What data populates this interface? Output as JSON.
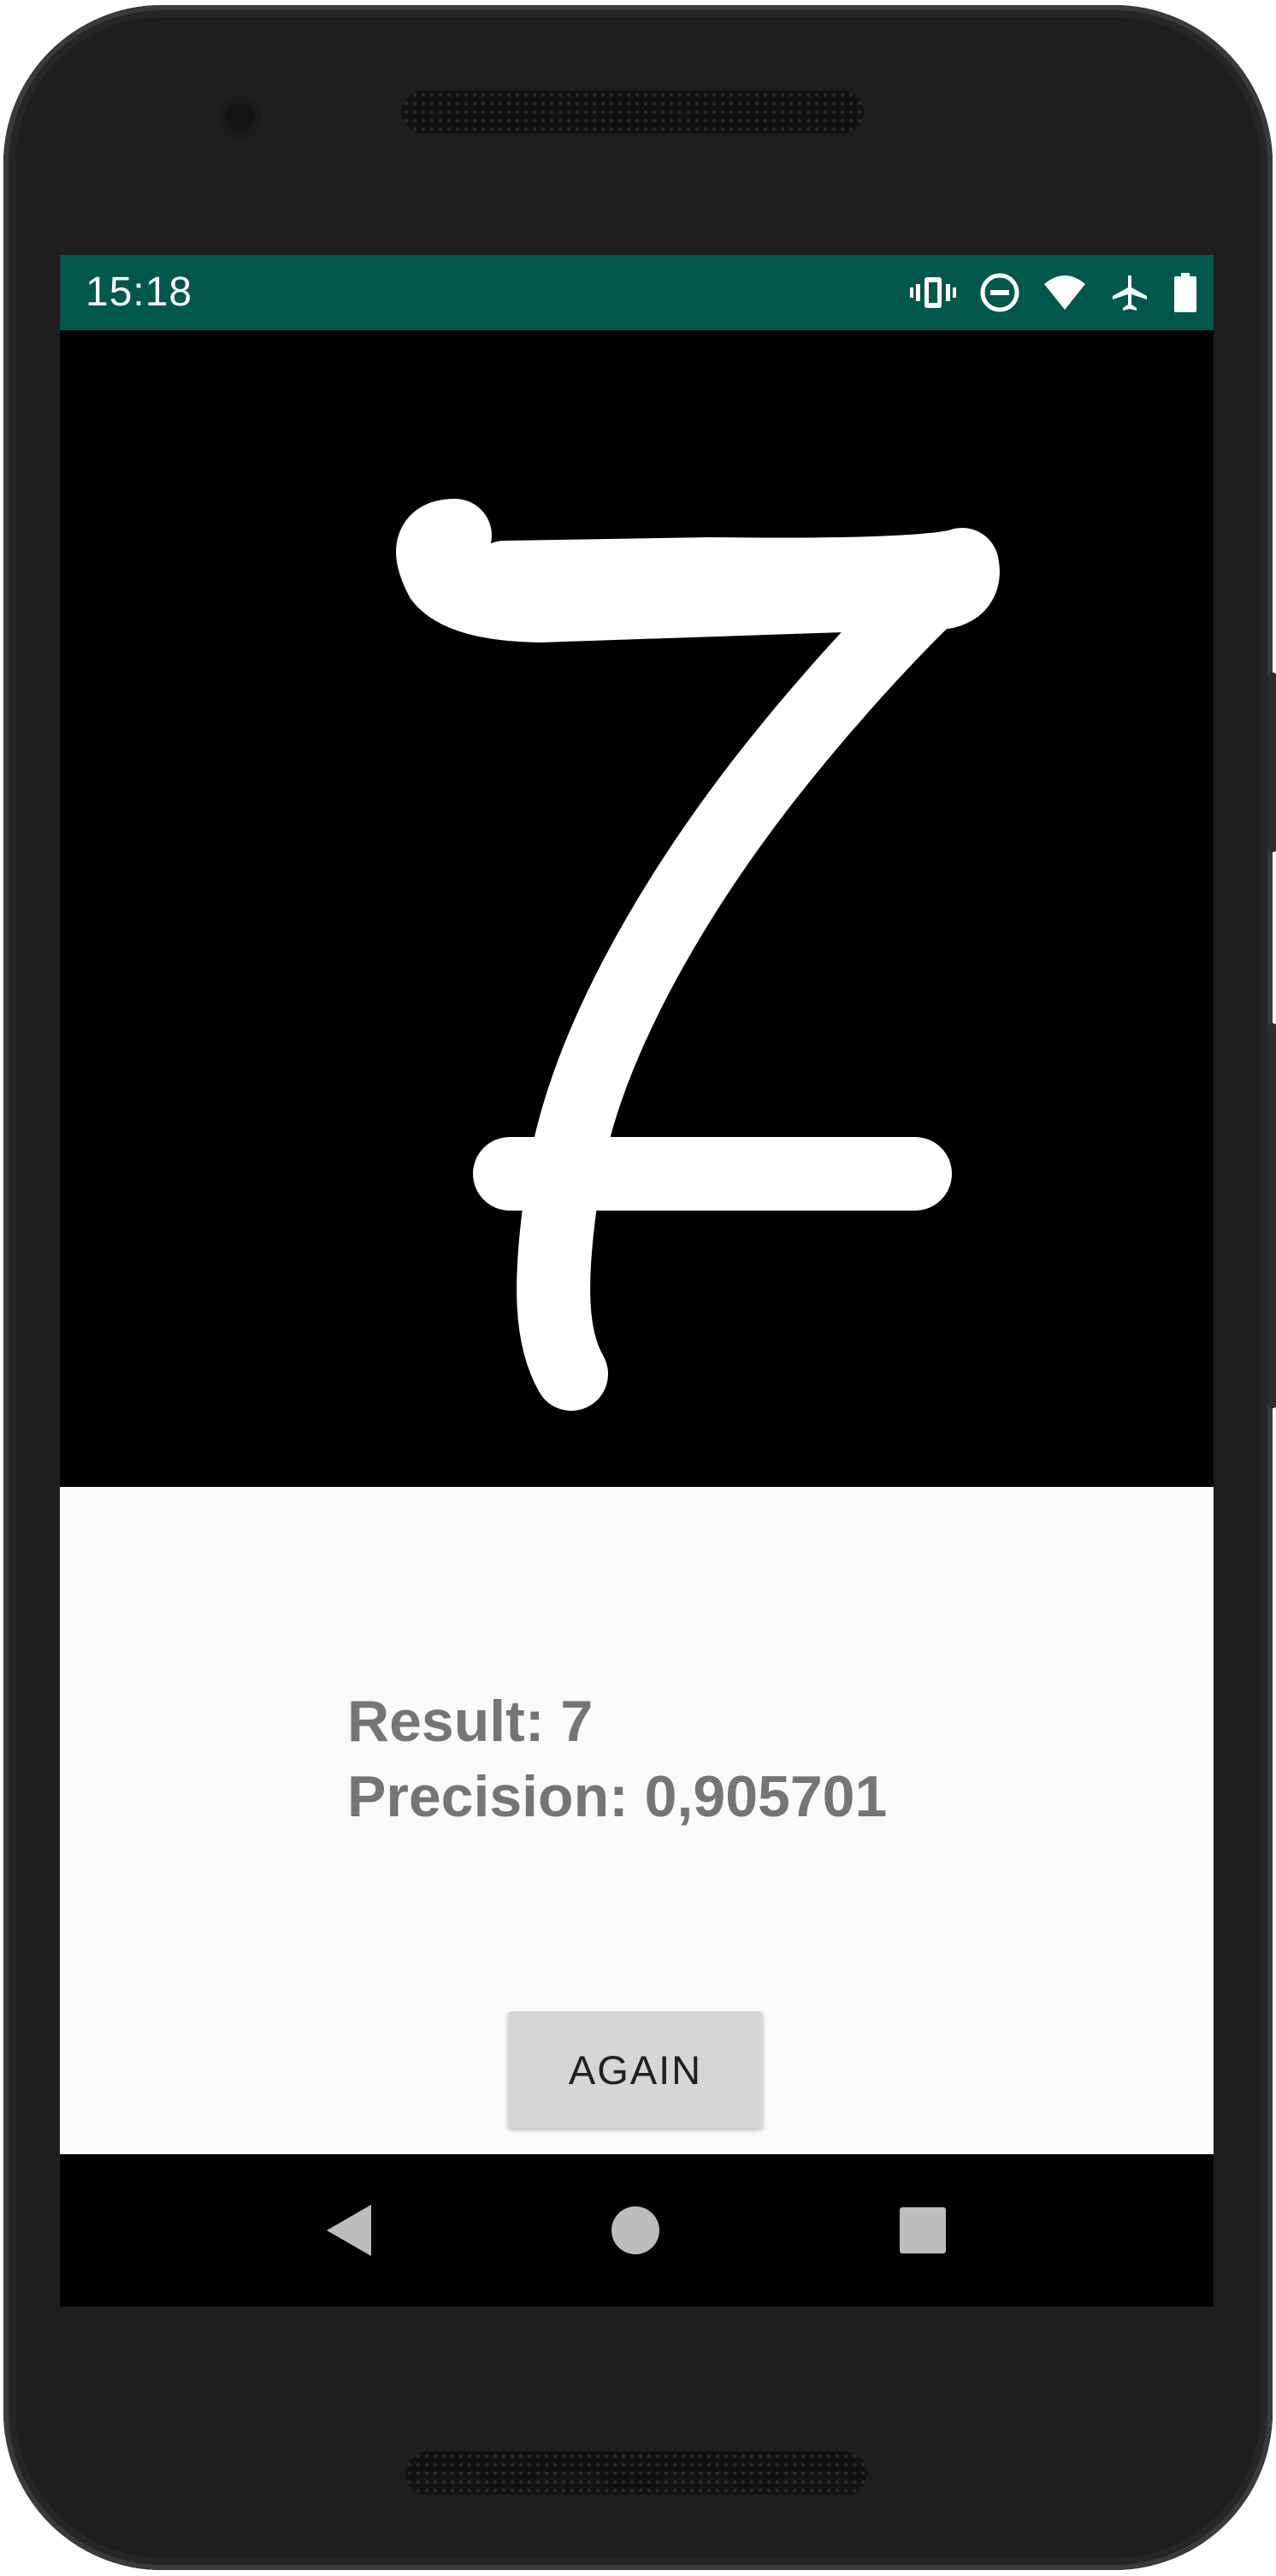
{
  "status_bar": {
    "time": "15:18",
    "icons": [
      "vibrate-icon",
      "do-not-disturb-icon",
      "wifi-icon",
      "airplane-mode-icon",
      "battery-icon"
    ],
    "color": "#00574b"
  },
  "canvas": {
    "drawn_digit_description": "handwritten digit stroke",
    "background": "#000000",
    "stroke_color": "#ffffff"
  },
  "result": {
    "result_line": "Result: 7",
    "precision_line": "Precision: 0,905701"
  },
  "actions": {
    "again_label": "AGAIN"
  },
  "navigation": {
    "icons": [
      "back-icon",
      "home-icon",
      "recents-icon"
    ]
  }
}
